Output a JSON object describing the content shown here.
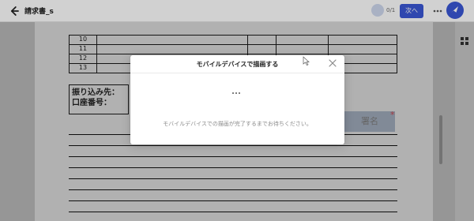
{
  "header": {
    "title": "請求書_s",
    "progress": "0/1",
    "next_label": "次へ"
  },
  "document": {
    "table_rows": [
      "10",
      "11",
      "12",
      "13"
    ],
    "payment_to": "振り込み先：",
    "account_no": "口座番号：",
    "sign_field": "署名",
    "required_mark": "*"
  },
  "modal": {
    "title": "モバイルデバイスで描画する",
    "message": "モバイルデバイスでの描画が完了するまでお待ちください。"
  },
  "colors": {
    "primary": "#3a57d6",
    "required": "#c8464e"
  },
  "icons": [
    "back-arrow-icon",
    "more-icon",
    "app-logo-icon",
    "grid-icon",
    "close-icon",
    "cursor-icon"
  ]
}
